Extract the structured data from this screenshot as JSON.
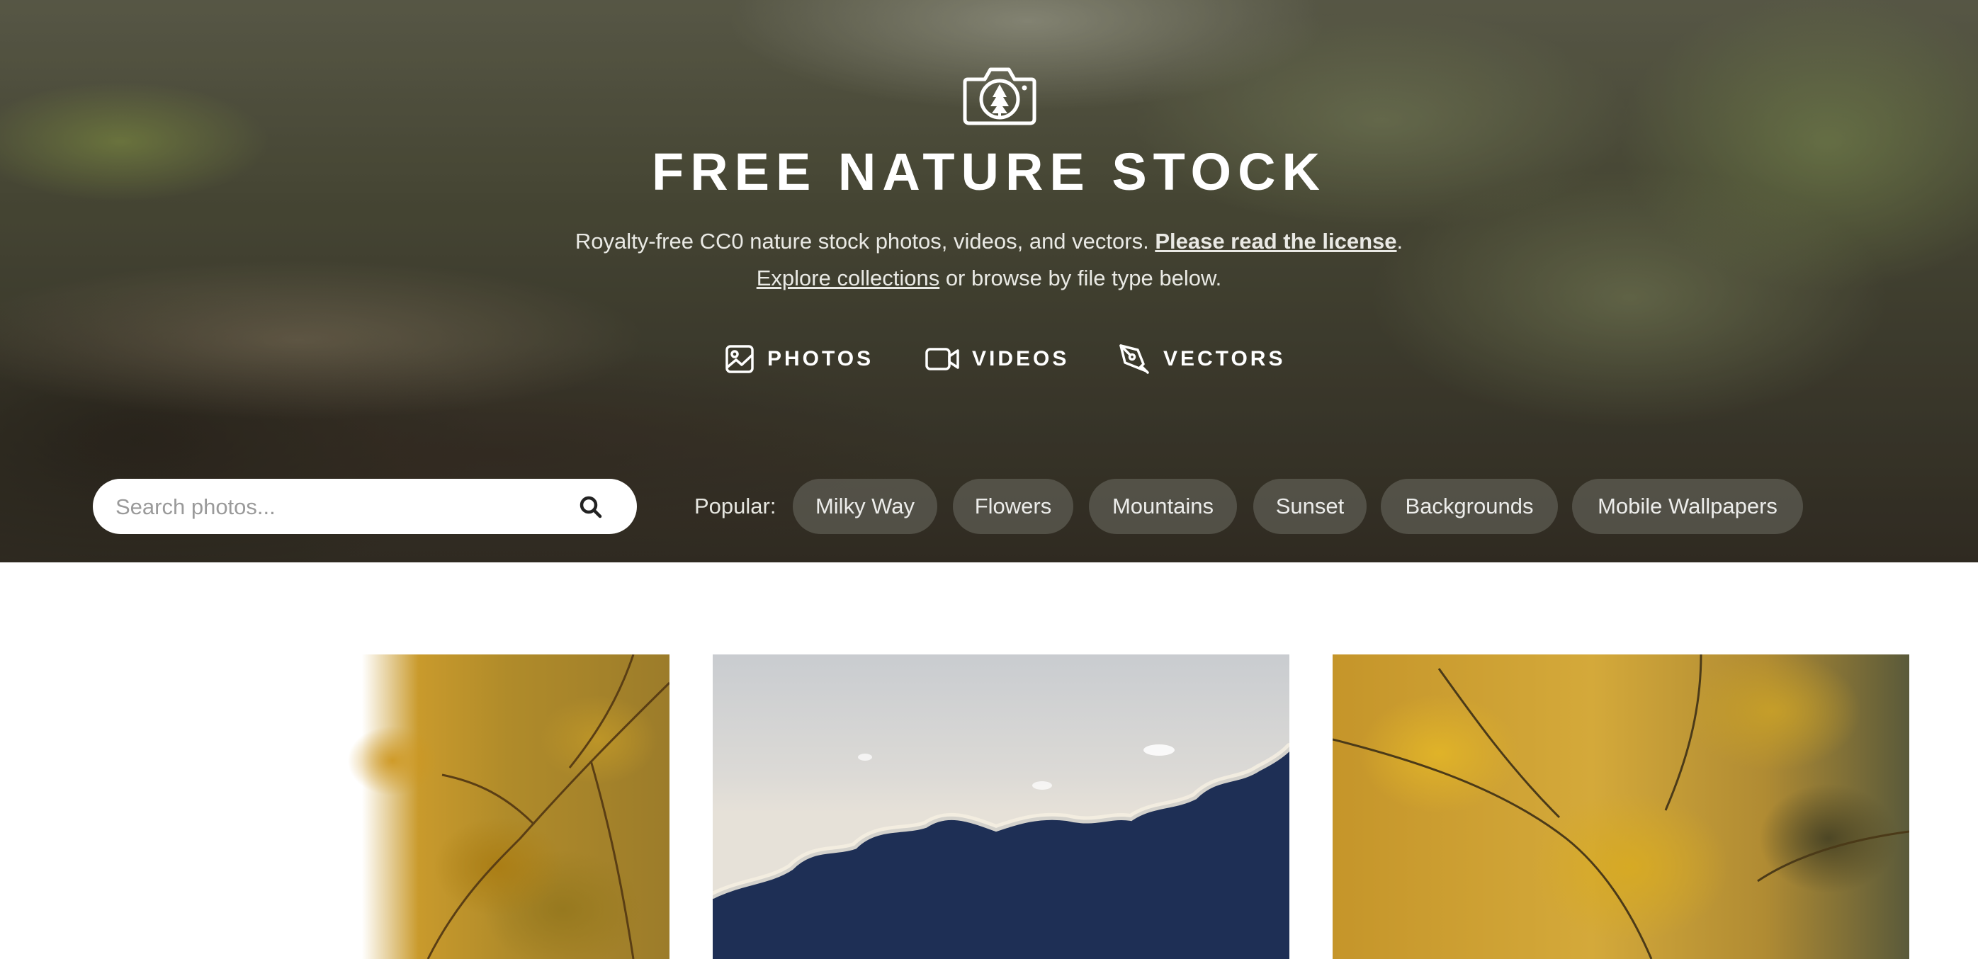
{
  "header": {
    "logo_icon": "camera-tree-icon",
    "title": "FREE NATURE STOCK",
    "tagline": {
      "line1_text": "Royalty-free CC0 nature stock photos, videos, and vectors. ",
      "license_link": "Please read the license",
      "line1_end": ".",
      "collections_link": "Explore collections",
      "line2_text": " or browse by file type below."
    },
    "file_types": [
      {
        "label": "PHOTOS",
        "icon": "image-icon"
      },
      {
        "label": "VIDEOS",
        "icon": "video-camera-icon"
      },
      {
        "label": "VECTORS",
        "icon": "pen-tool-icon"
      }
    ]
  },
  "search": {
    "placeholder": "Search photos...",
    "button_icon": "search-icon"
  },
  "popular": {
    "label": "Popular:",
    "tags": [
      "Milky Way",
      "Flowers",
      "Mountains",
      "Sunset",
      "Backgrounds",
      "Mobile Wallpapers"
    ]
  },
  "gallery": {
    "images": [
      {
        "subject": "autumn yellow maple leaves"
      },
      {
        "subject": "sunlit clouds against sky"
      },
      {
        "subject": "golden autumn tree canopy"
      }
    ]
  },
  "colors": {
    "hero_text": "#ffffff",
    "tag_background": "#6e6e64",
    "page_background": "#ffffff"
  }
}
